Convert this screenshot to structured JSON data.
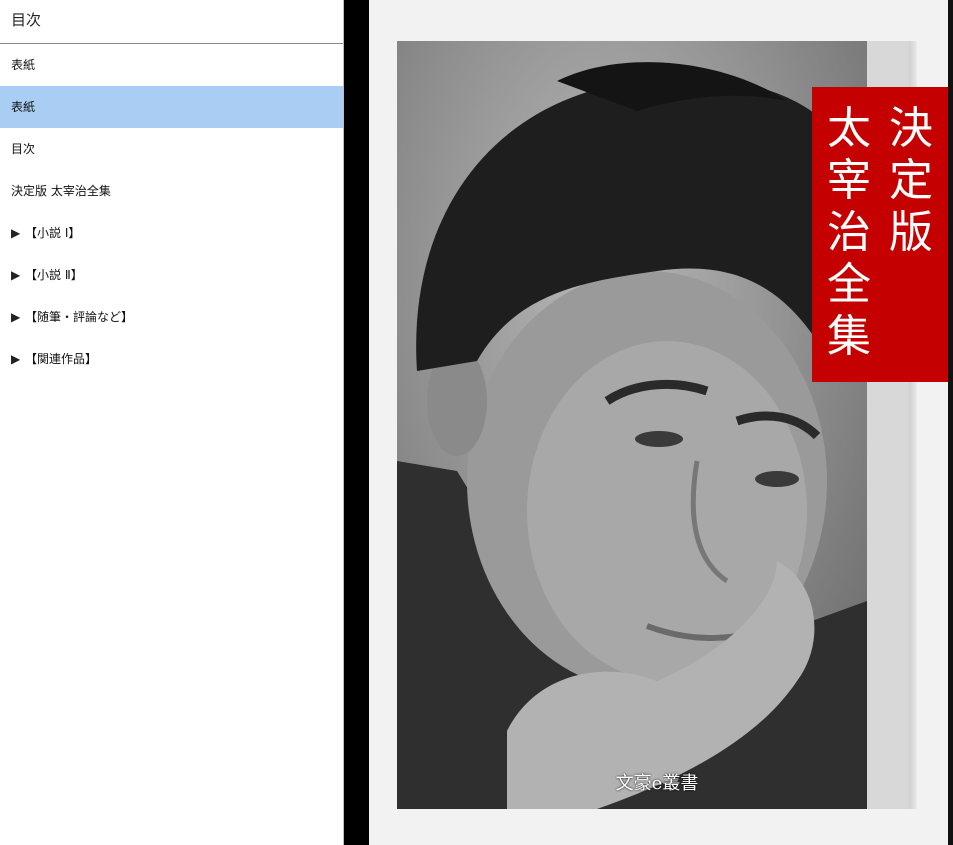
{
  "toc": {
    "header": "目次",
    "items": [
      {
        "label": "表紙",
        "arrow": "",
        "selected": false
      },
      {
        "label": "表紙",
        "arrow": "",
        "selected": true
      },
      {
        "label": "目次",
        "arrow": "",
        "selected": false
      },
      {
        "label": "決定版 太宰治全集",
        "arrow": "",
        "selected": false
      },
      {
        "label": "【小説 Ⅰ】",
        "arrow": "▶",
        "selected": false
      },
      {
        "label": "【小説 Ⅱ】",
        "arrow": "▶",
        "selected": false
      },
      {
        "label": "【随筆・評論など】",
        "arrow": "▶",
        "selected": false
      },
      {
        "label": "【関連作品】",
        "arrow": "▶",
        "selected": false
      }
    ]
  },
  "cover": {
    "title_col1": "決定版",
    "title_col2": "太宰治全集",
    "publisher": "文豪e叢書",
    "band_color": "#c40000"
  }
}
